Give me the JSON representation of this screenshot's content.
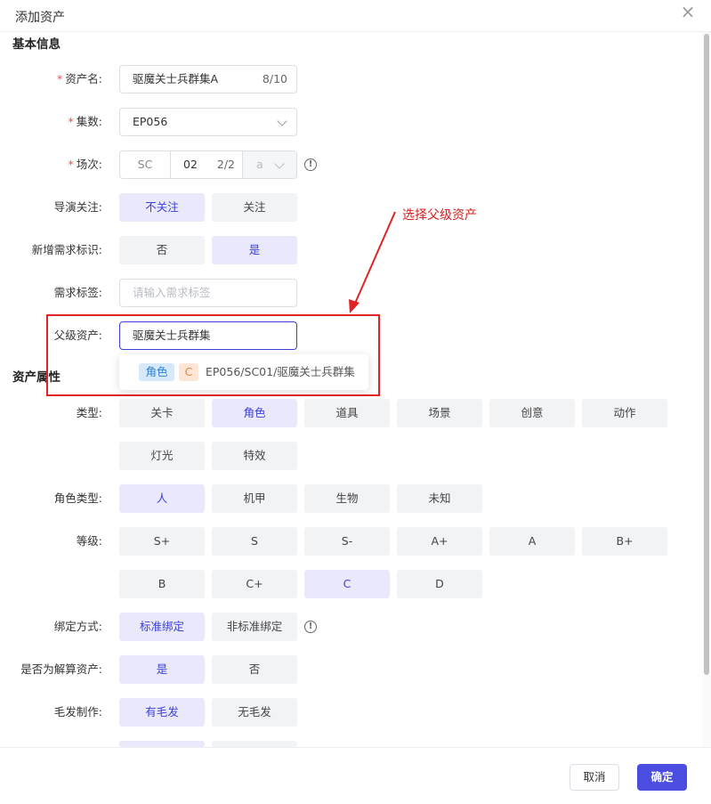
{
  "dialog": {
    "title": "添加资产",
    "close_icon": "close-icon"
  },
  "sections": {
    "basic": "基本信息",
    "attributes": "资产属性"
  },
  "fields": {
    "asset_name": {
      "label": "资产名:",
      "value": "驱魔关士兵群集A",
      "count": "8/10"
    },
    "episode": {
      "label": "集数:",
      "value": "EP056"
    },
    "scene": {
      "label": "场次:",
      "prefix": "SC",
      "number": "02",
      "count": "2/2",
      "suffix": "a"
    },
    "director_focus": {
      "label": "导演关注:",
      "options": [
        "不关注",
        "关注"
      ],
      "selected": "不关注"
    },
    "new_demand": {
      "label": "新增需求标识:",
      "options": [
        "否",
        "是"
      ],
      "selected": "是"
    },
    "demand_tag": {
      "label": "需求标签:",
      "placeholder": "请输入需求标签"
    },
    "parent_asset": {
      "label": "父级资产:",
      "value": "驱魔关士兵群集",
      "suggestion": {
        "tag": "角色",
        "grade": "C",
        "path": "EP056/SC01/驱魔关士兵群集"
      }
    },
    "type": {
      "label": "类型:",
      "options": [
        "关卡",
        "角色",
        "道具",
        "场景",
        "创意",
        "动作",
        "灯光",
        "特效"
      ],
      "selected": "角色"
    },
    "role_type": {
      "label": "角色类型:",
      "options": [
        "人",
        "机甲",
        "生物",
        "未知"
      ],
      "selected": "人"
    },
    "level": {
      "label": "等级:",
      "options": [
        "S+",
        "S",
        "S-",
        "A+",
        "A",
        "B+",
        "B",
        "C+",
        "C",
        "D"
      ],
      "selected": "C"
    },
    "binding": {
      "label": "绑定方式:",
      "options": [
        "标准绑定",
        "非标准绑定"
      ],
      "selected": "标准绑定"
    },
    "is_solve": {
      "label": "是否为解算资产:",
      "options": [
        "是",
        "否"
      ],
      "selected": "是"
    },
    "hair": {
      "label": "毛发制作:",
      "options": [
        "有毛发",
        "无毛发"
      ],
      "selected": "有毛发"
    }
  },
  "annotation": {
    "text": "选择父级资产",
    "color": "#d42020"
  },
  "footer": {
    "cancel": "取消",
    "confirm": "确定"
  },
  "colors": {
    "accent": "#4a4de0",
    "selected_bg": "#e9e9fb",
    "annotation_red": "#e02424"
  }
}
